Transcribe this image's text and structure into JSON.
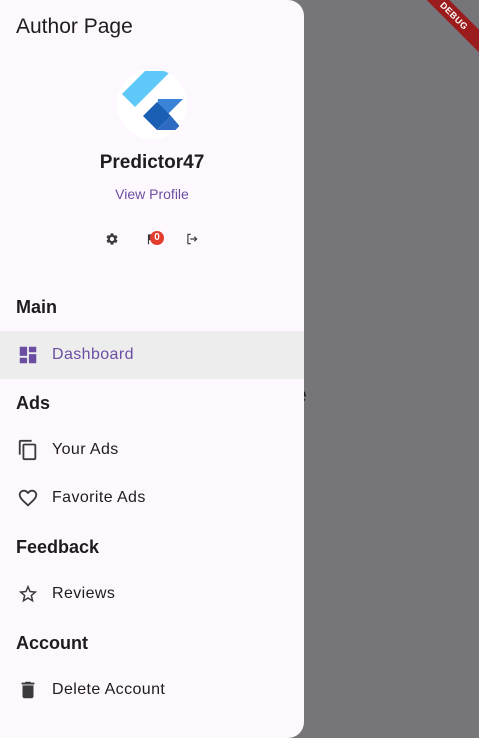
{
  "background": {
    "page_text": "age"
  },
  "debug_banner": "DEBUG",
  "drawer": {
    "title": "Author Page",
    "profile": {
      "username": "Predictor47",
      "view_profile": "View Profile",
      "notification_count": "0"
    },
    "sections": {
      "main": "Main",
      "ads": "Ads",
      "feedback": "Feedback",
      "account": "Account"
    },
    "items": {
      "dashboard": "Dashboard",
      "your_ads": "Your Ads",
      "favorite_ads": "Favorite Ads",
      "reviews": "Reviews",
      "delete_account": "Delete Account"
    }
  },
  "colors": {
    "accent": "#6b4ea2",
    "selected_bg": "#ededed",
    "drawer_bg": "#fdf8fd",
    "scrim": "#76757a",
    "badge": "#e23c2c"
  }
}
